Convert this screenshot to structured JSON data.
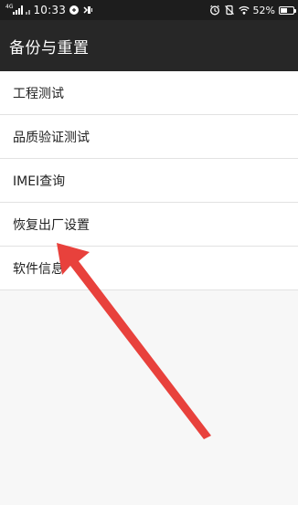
{
  "status_bar": {
    "network_type": "4G",
    "time": "10:33",
    "battery_percent": "52%",
    "battery_level": 0.52,
    "left_icons": [
      "signal-icon",
      "signal-small-icon",
      "notification-icon",
      "vibrate-icon"
    ],
    "right_icons": [
      "alarm-icon",
      "silent-icon",
      "wifi-icon",
      "battery-icon"
    ]
  },
  "app_bar": {
    "title": "备份与重置"
  },
  "menu": {
    "items": [
      {
        "label": "工程测试"
      },
      {
        "label": "品质验证测试"
      },
      {
        "label": "IMEI查询"
      },
      {
        "label": "恢复出厂设置"
      },
      {
        "label": "软件信息"
      }
    ]
  },
  "annotation": {
    "arrow_color": "#e8413c",
    "points_to": "恢复出厂设置"
  }
}
